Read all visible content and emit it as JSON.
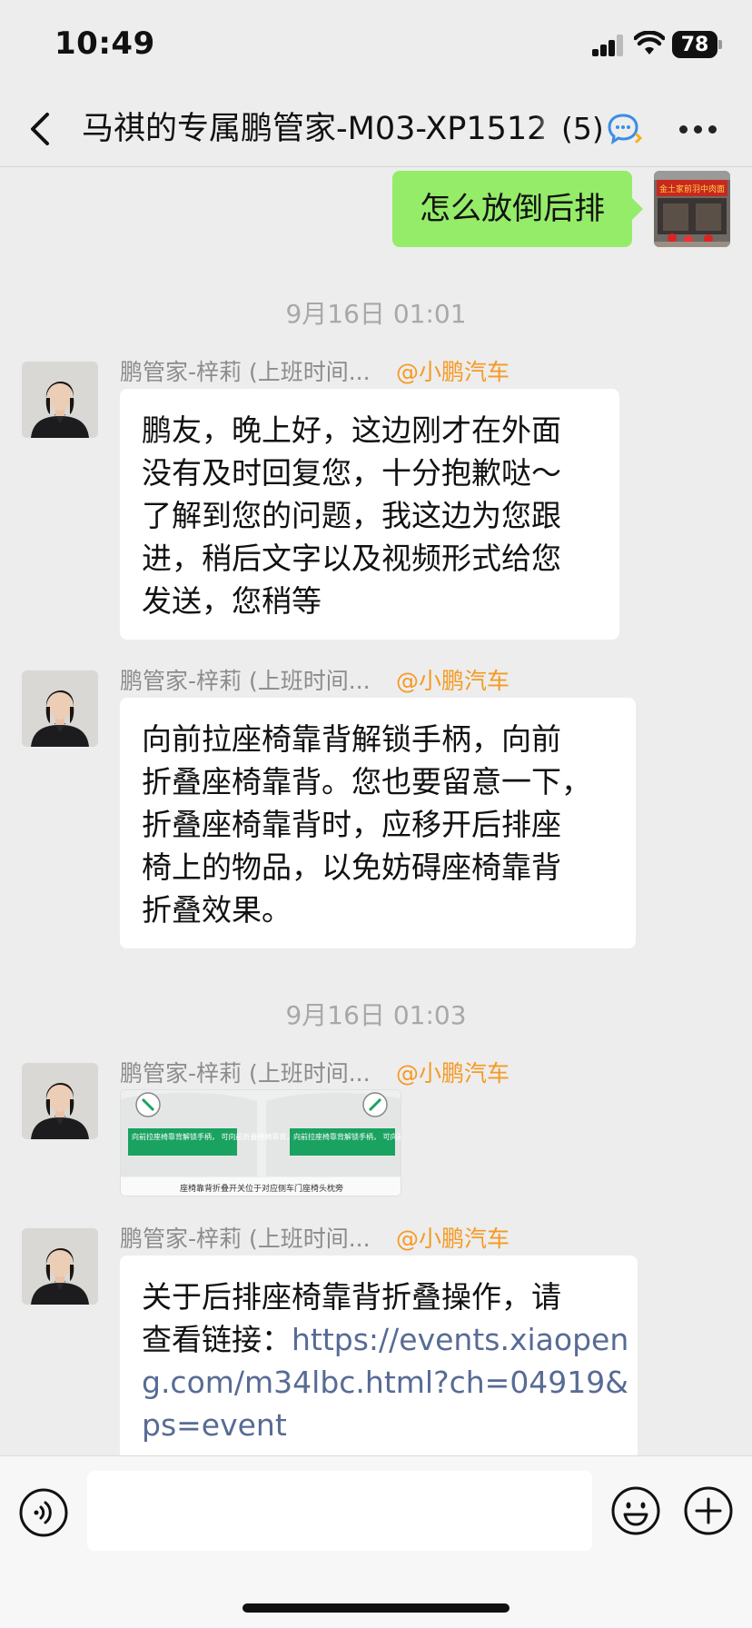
{
  "status": {
    "time": "10:49",
    "battery": "78"
  },
  "header": {
    "title": "马祺的专属鹏管家-M03-XP1512",
    "count": "(5)",
    "back_icon": "chevron-left-icon",
    "more_icon": "more-dots-icon"
  },
  "messages": {
    "outgoing": {
      "text": "怎么放倒后排",
      "avatar_sign": "金土家前羽中肉面"
    },
    "time1": "9月16日 01:01",
    "msg1": {
      "sender": "鹏管家-梓莉 (上班时间...",
      "tag": "@小鹏汽车",
      "lines": [
        "鹏友，晚上好，这边刚才在外面",
        "没有及时回复您，十分抱歉哒～",
        "了解到您的问题，我这边为您跟",
        "进，稍后文字以及视频形式给您",
        "发送，您稍等"
      ]
    },
    "msg2": {
      "sender": "鹏管家-梓莉 (上班时间...",
      "tag": "@小鹏汽车",
      "lines": [
        "向前拉座椅靠背解锁手柄，向前",
        "折叠座椅靠背。您也要留意一下，",
        "折叠座椅靠背时，应移开后排座",
        "椅上的物品，以免妨碍座椅靠背",
        "折叠效果。"
      ]
    },
    "time2": "9月16日 01:03",
    "msg3": {
      "sender": "鹏管家-梓莉 (上班时间...",
      "tag": "@小鹏汽车",
      "image": {
        "label_left": "向前拉座椅靠背解锁手柄，\n可向前折叠座椅靠背。",
        "label_right": "向前拉座椅靠背解锁手柄，\n可向前折叠座椅靠背。",
        "caption": "座椅靠背折叠开关位于对应侧车门座椅头枕旁"
      }
    },
    "msg4": {
      "sender": "鹏管家-梓莉 (上班时间...",
      "tag": "@小鹏汽车",
      "text_line1": "关于后排座椅靠背折叠操作，请",
      "text_line2_prefix": "查看链接：",
      "link_line1": "https://events.xiaopen",
      "link_line2": "g.com/m34lbc.html?ch=04919&",
      "link_line3": "ps=event"
    }
  },
  "input_bar": {
    "voice_icon": "voice-icon",
    "emoji_icon": "emoji-icon",
    "plus_icon": "plus-icon",
    "placeholder": ""
  },
  "colors": {
    "bubble_out": "#95ec69",
    "sender_tag": "#f59a24",
    "link": "#576b95",
    "timestamp": "#a8a8a8"
  }
}
